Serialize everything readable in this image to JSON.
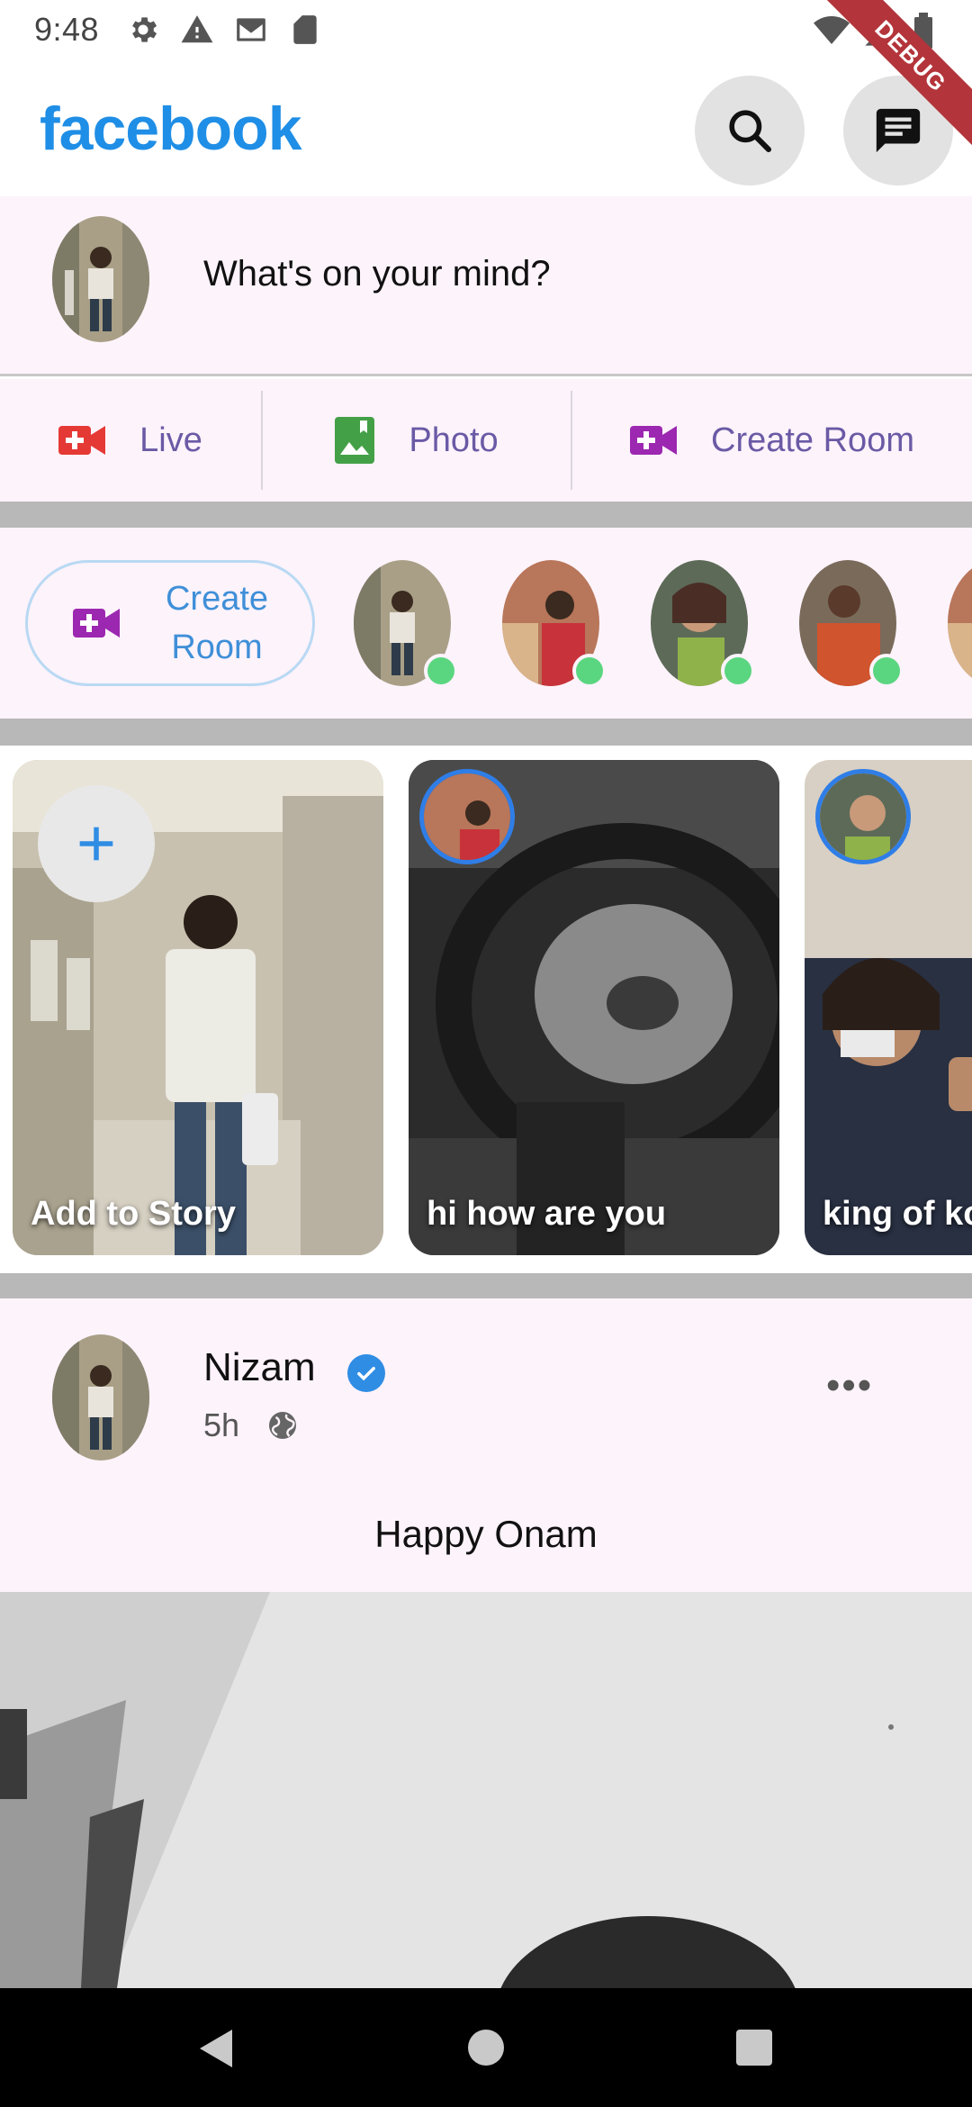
{
  "status_bar": {
    "time": "9:48",
    "icons": [
      "gear-icon",
      "alert-icon",
      "gmail-icon",
      "sd-card-icon"
    ],
    "right_icons": [
      "wifi-icon",
      "signal-icon",
      "battery-icon"
    ]
  },
  "debug_banner": "DEBUG",
  "app_bar": {
    "logo": "facebook",
    "logo_color": "#1f8ee6",
    "actions": [
      "search-icon",
      "messenger-icon"
    ]
  },
  "composer": {
    "placeholder": "What's on your mind?"
  },
  "actions": [
    {
      "label": "Live",
      "icon": "video-icon",
      "color": "#e53935"
    },
    {
      "label": "Photo",
      "icon": "gallery-icon",
      "color": "#43a047"
    },
    {
      "label": "Create Room",
      "icon": "video-add-icon",
      "color": "#9c27b0"
    }
  ],
  "rooms": {
    "create_label_line1": "Create",
    "create_label_line2": "Room",
    "online_color": "#5bd680"
  },
  "stories": [
    {
      "label": "Add to Story"
    },
    {
      "label": "hi how are you"
    },
    {
      "label": "king of ko"
    }
  ],
  "post": {
    "author": "Nizam",
    "time": "5h",
    "text": "Happy Onam",
    "more": "•••"
  }
}
